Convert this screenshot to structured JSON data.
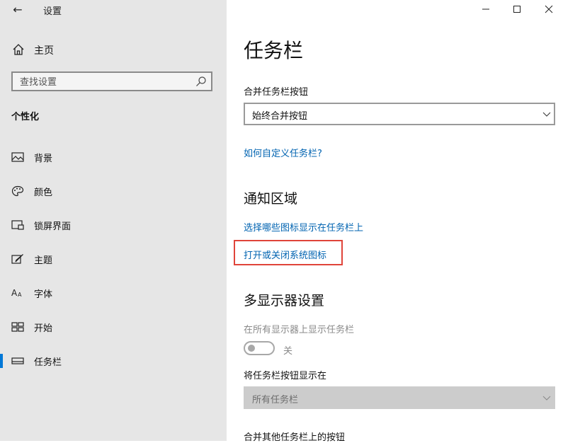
{
  "window": {
    "title": "设置",
    "back_icon": "←",
    "minimize_icon": "—",
    "maximize_icon": "☐",
    "close_icon": "✕"
  },
  "sidebar": {
    "home_label": "主页",
    "search_placeholder": "查找设置",
    "section_title": "个性化",
    "items": [
      {
        "label": "背景",
        "icon": "image-icon"
      },
      {
        "label": "颜色",
        "icon": "palette-icon"
      },
      {
        "label": "锁屏界面",
        "icon": "lock-screen-icon"
      },
      {
        "label": "主题",
        "icon": "theme-brush-icon"
      },
      {
        "label": "字体",
        "icon": "font-icon"
      },
      {
        "label": "开始",
        "icon": "start-icon"
      },
      {
        "label": "任务栏",
        "icon": "taskbar-icon",
        "selected": true
      }
    ],
    "accent_color": "#0078d7"
  },
  "main": {
    "title": "任务栏",
    "combine_label": "合并任务栏按钮",
    "combine_value": "始终合并按钮",
    "customize_link": "如何自定义任务栏?",
    "notification_heading": "通知区域",
    "select_icons_link": "选择哪些图标显示在任务栏上",
    "system_icons_link": "打开或关闭系统图标",
    "multi_display_heading": "多显示器设置",
    "show_all_label": "在所有显示器上显示任务栏",
    "toggle_state": "关",
    "show_buttons_label": "将任务栏按钮显示在",
    "show_buttons_value": "所有任务栏",
    "combine_other_label": "合并其他任务栏上的按钮",
    "link_color": "#0063b1",
    "highlight_color": "#e0443a"
  }
}
